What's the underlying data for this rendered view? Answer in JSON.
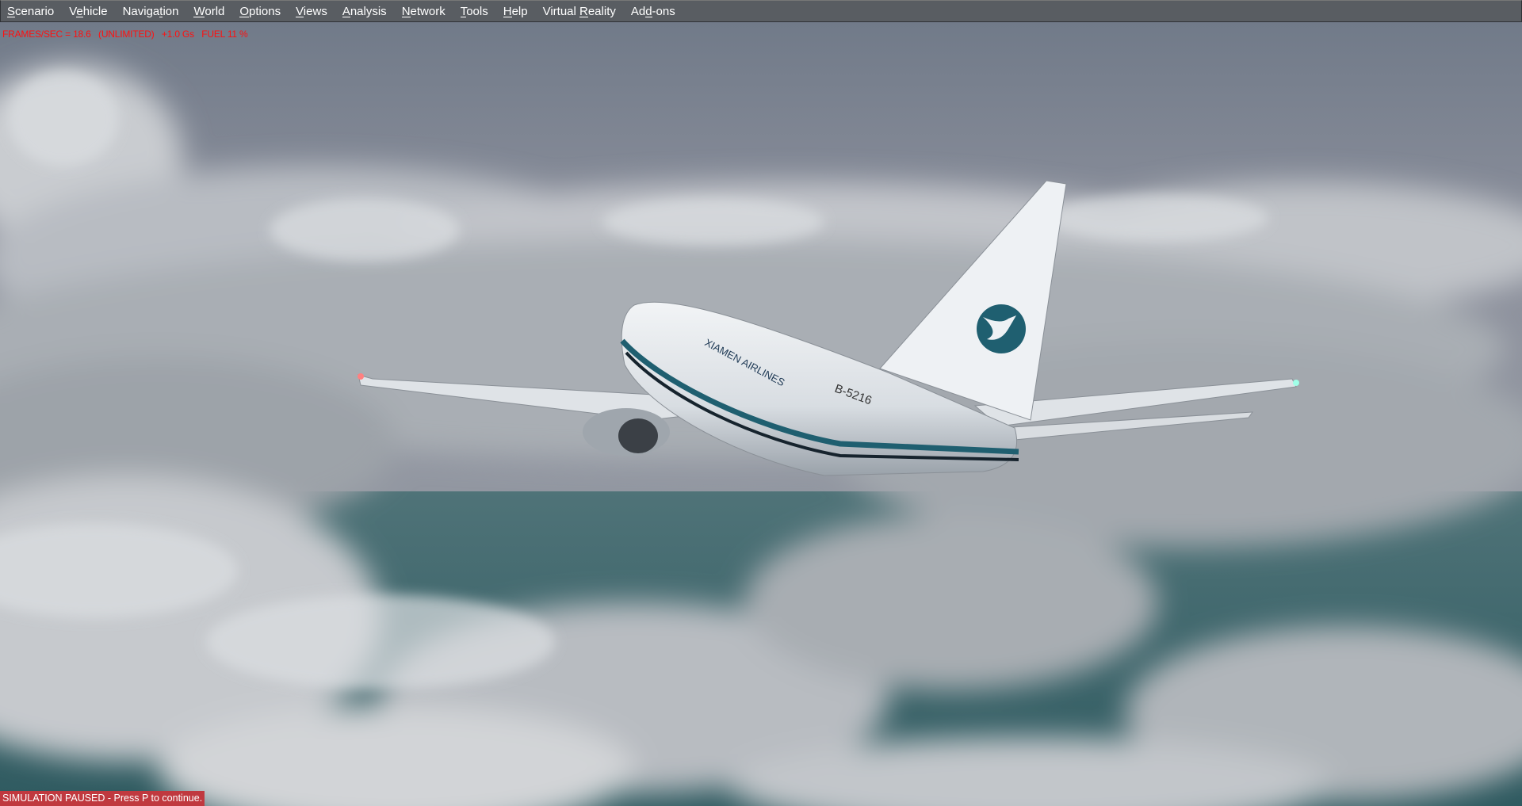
{
  "menu": {
    "items": [
      {
        "label": "Scenario",
        "accel": 0
      },
      {
        "label": "Vehicle",
        "accel": 1
      },
      {
        "label": "Navigation",
        "accel": 6
      },
      {
        "label": "World",
        "accel": 0
      },
      {
        "label": "Options",
        "accel": 0
      },
      {
        "label": "Views",
        "accel": 0
      },
      {
        "label": "Analysis",
        "accel": 0
      },
      {
        "label": "Network",
        "accel": 0
      },
      {
        "label": "Tools",
        "accel": 0
      },
      {
        "label": "Help",
        "accel": 0
      },
      {
        "label": "Virtual Reality",
        "accel": 8
      },
      {
        "label": "Add-ons",
        "accel": 2
      }
    ]
  },
  "hud": {
    "text": "FRAMES/SEC = 18.6   (UNLIMITED)   +1.0 Gs   FUEL 11 %",
    "color": "#ff1010"
  },
  "status": {
    "paused_text": "SIMULATION PAUSED - Press P to continue.",
    "color": "#c0393f"
  },
  "aircraft": {
    "airline": "XIAMEN AIRLINES",
    "registration": "B-5216",
    "logo_color": "#1f5f70"
  }
}
